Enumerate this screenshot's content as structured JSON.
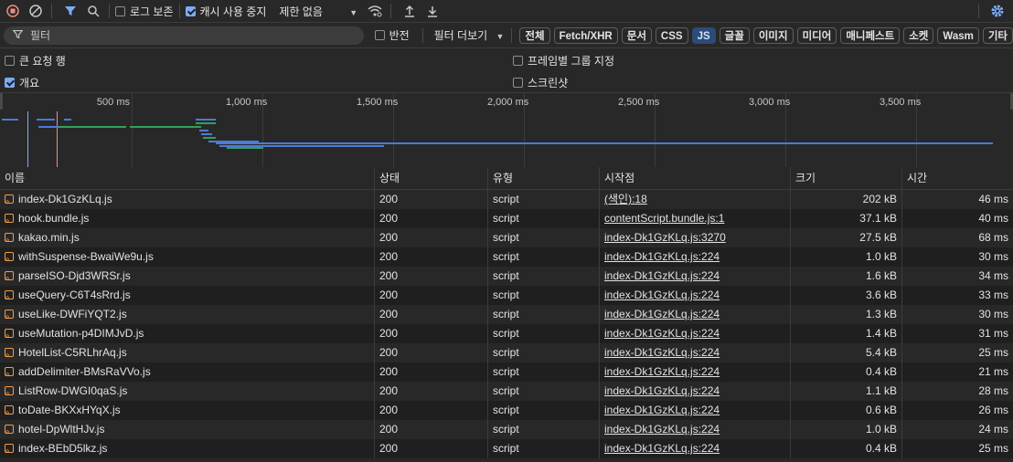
{
  "toolbar": {
    "preserve_log": "로그 보존",
    "disable_cache": "캐시 사용 중지",
    "throttle": "제한 없음"
  },
  "filter": {
    "placeholder": "필터",
    "invert": "반전",
    "more_filters": "필터 더보기",
    "types": [
      "전체",
      "Fetch/XHR",
      "문서",
      "CSS",
      "JS",
      "글꼴",
      "이미지",
      "미디어",
      "매니페스트",
      "소켓",
      "Wasm",
      "기타"
    ],
    "active_type": "JS"
  },
  "options": {
    "big_rows": "큰 요청 행",
    "group_by_frame": "프레임별 그룹 지정",
    "overview": "개요",
    "screenshots": "스크린샷"
  },
  "overview": {
    "ticks": [
      "500 ms",
      "1,000 ms",
      "1,500 ms",
      "2,000 ms",
      "2,500 ms",
      "3,000 ms",
      "3,500 ms"
    ]
  },
  "table": {
    "headers": [
      "이름",
      "상태",
      "유형",
      "시작점",
      "크기",
      "시간"
    ],
    "rows": [
      {
        "name": "index-Dk1GzKLq.js",
        "status": "200",
        "type": "script",
        "initiator": "(색인):18",
        "size": "202 kB",
        "time": "46 ms"
      },
      {
        "name": "hook.bundle.js",
        "status": "200",
        "type": "script",
        "initiator": "contentScript.bundle.js:1",
        "size": "37.1 kB",
        "time": "40 ms"
      },
      {
        "name": "kakao.min.js",
        "status": "200",
        "type": "script",
        "initiator": "index-Dk1GzKLq.js:3270",
        "size": "27.5 kB",
        "time": "68 ms"
      },
      {
        "name": "withSuspense-BwaiWe9u.js",
        "status": "200",
        "type": "script",
        "initiator": "index-Dk1GzKLq.js:224",
        "size": "1.0 kB",
        "time": "30 ms"
      },
      {
        "name": "parseISO-Djd3WRSr.js",
        "status": "200",
        "type": "script",
        "initiator": "index-Dk1GzKLq.js:224",
        "size": "1.6 kB",
        "time": "34 ms"
      },
      {
        "name": "useQuery-C6T4sRrd.js",
        "status": "200",
        "type": "script",
        "initiator": "index-Dk1GzKLq.js:224",
        "size": "3.6 kB",
        "time": "33 ms"
      },
      {
        "name": "useLike-DWFiYQT2.js",
        "status": "200",
        "type": "script",
        "initiator": "index-Dk1GzKLq.js:224",
        "size": "1.3 kB",
        "time": "30 ms"
      },
      {
        "name": "useMutation-p4DIMJvD.js",
        "status": "200",
        "type": "script",
        "initiator": "index-Dk1GzKLq.js:224",
        "size": "1.4 kB",
        "time": "31 ms"
      },
      {
        "name": "HotelList-C5RLhrAq.js",
        "status": "200",
        "type": "script",
        "initiator": "index-Dk1GzKLq.js:224",
        "size": "5.4 kB",
        "time": "25 ms"
      },
      {
        "name": "addDelimiter-BMsRaVVo.js",
        "status": "200",
        "type": "script",
        "initiator": "index-Dk1GzKLq.js:224",
        "size": "0.4 kB",
        "time": "21 ms"
      },
      {
        "name": "ListRow-DWGI0qaS.js",
        "status": "200",
        "type": "script",
        "initiator": "index-Dk1GzKLq.js:224",
        "size": "1.1 kB",
        "time": "28 ms"
      },
      {
        "name": "toDate-BKXxHYqX.js",
        "status": "200",
        "type": "script",
        "initiator": "index-Dk1GzKLq.js:224",
        "size": "0.6 kB",
        "time": "26 ms"
      },
      {
        "name": "hotel-DpWltHJv.js",
        "status": "200",
        "type": "script",
        "initiator": "index-Dk1GzKLq.js:224",
        "size": "1.0 kB",
        "time": "24 ms"
      },
      {
        "name": "index-BEbD5lkz.js",
        "status": "200",
        "type": "script",
        "initiator": "index-Dk1GzKLq.js:224",
        "size": "0.4 kB",
        "time": "25 ms"
      }
    ]
  }
}
